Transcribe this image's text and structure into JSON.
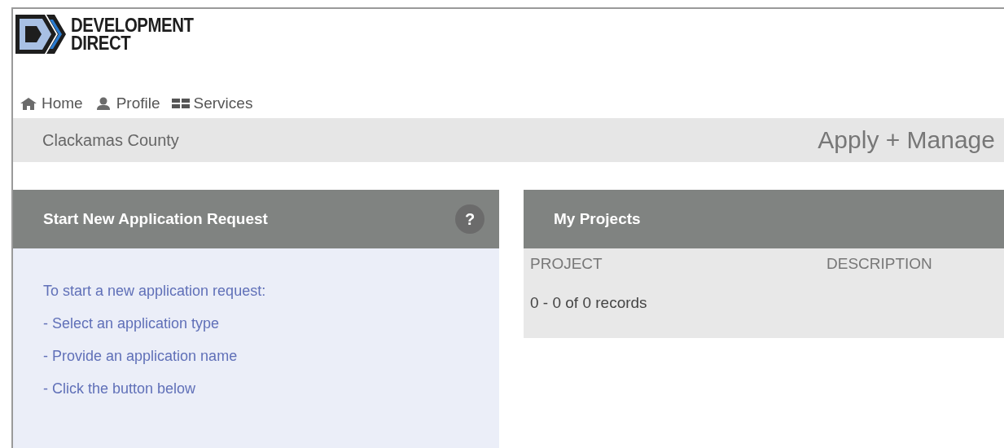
{
  "logo": {
    "line_1": "DEVELOPMENT",
    "line_2": "DIRECT"
  },
  "nav": [
    {
      "label": "Home"
    },
    {
      "label": "Profile"
    },
    {
      "label": "Services"
    }
  ],
  "banner": {
    "county": "Clackamas County",
    "title": "Apply + Manage"
  },
  "start_panel": {
    "title": "Start New Application Request",
    "help": "?",
    "lines": [
      "To start a new application request:",
      "- Select an application type",
      "- Provide an application name",
      "- Click the button below"
    ]
  },
  "projects_panel": {
    "title": "My Projects",
    "columns": [
      "PROJECT",
      "DESCRIPTION"
    ],
    "records": "0 - 0 of 0 records"
  }
}
